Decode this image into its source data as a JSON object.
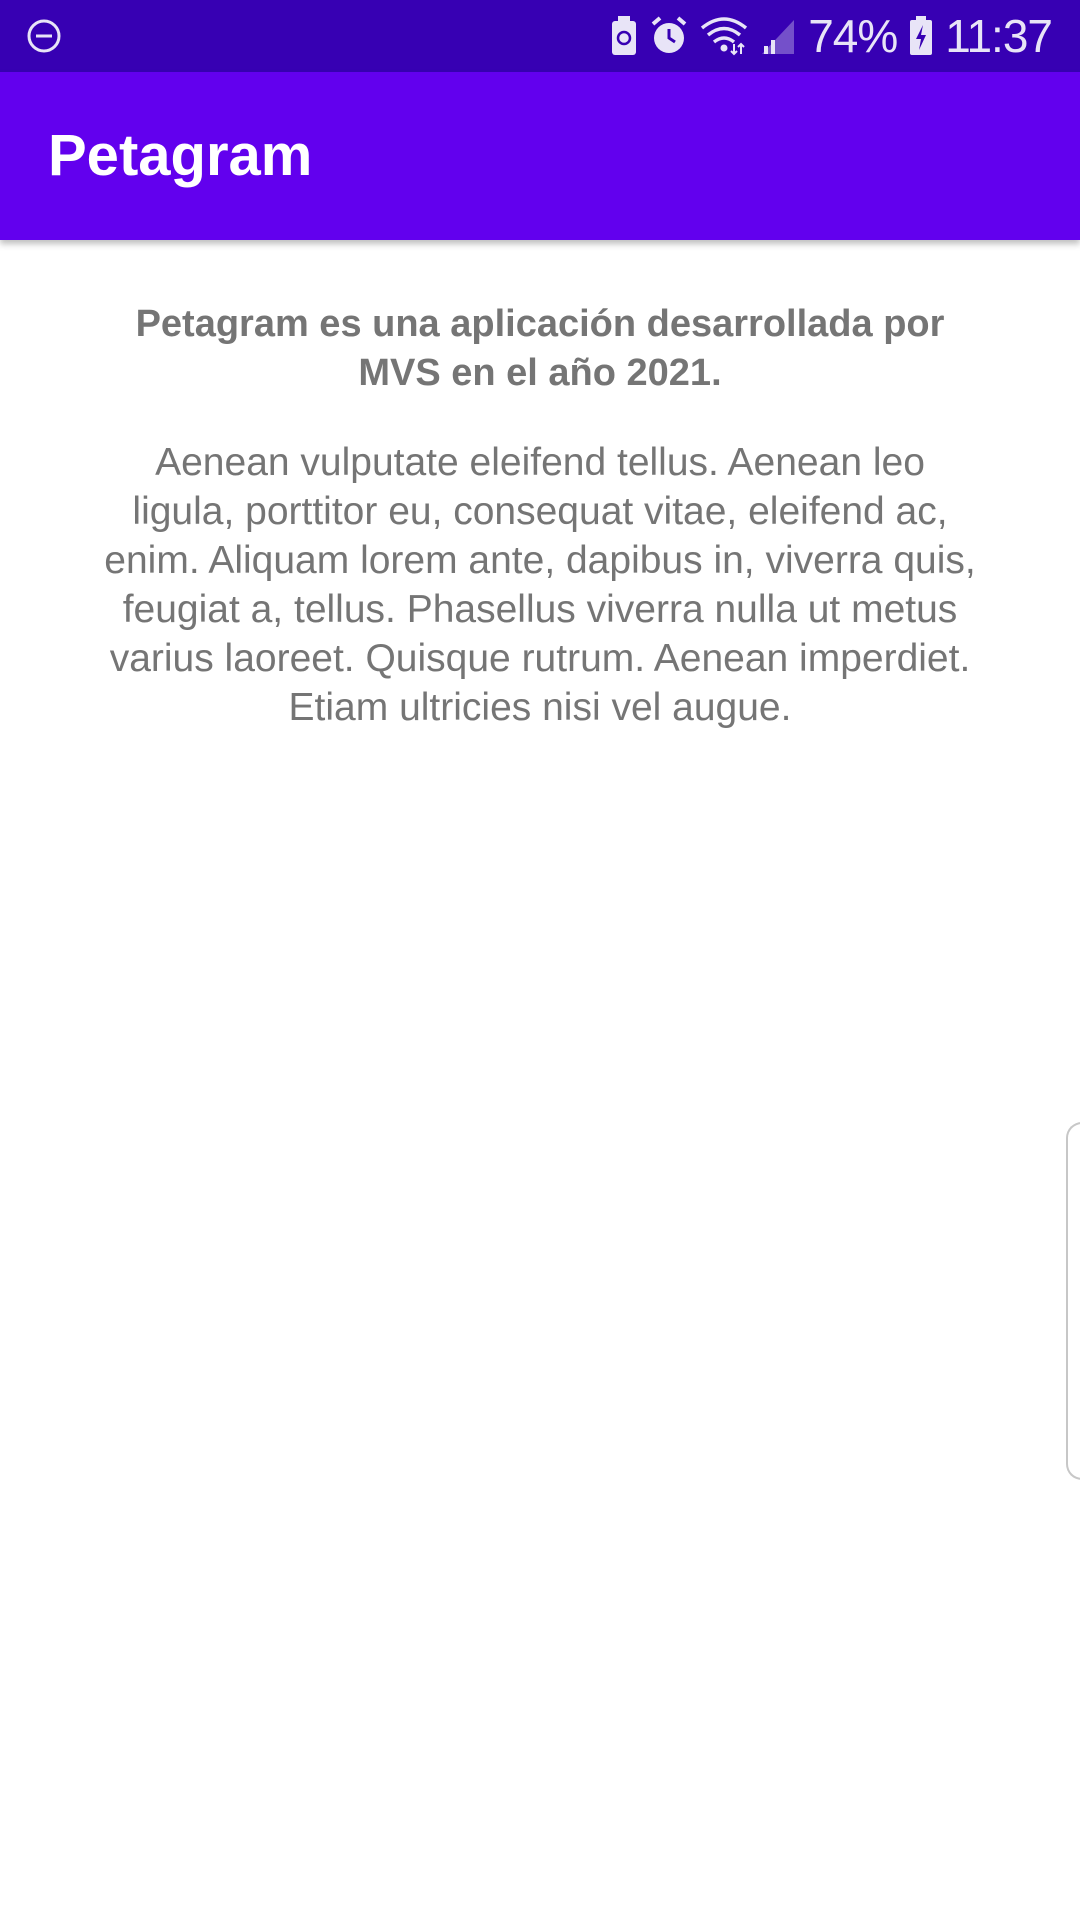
{
  "status_bar": {
    "battery_percent": "74%",
    "time": "11:37",
    "icons": [
      "do-not-disturb-icon",
      "battery-saver-icon",
      "alarm-icon",
      "wifi-icon",
      "signal-icon",
      "battery-charging-icon"
    ]
  },
  "app_bar": {
    "title": "Petagram",
    "background_color": "#6200EE"
  },
  "content": {
    "headline": "Petagram es una aplicación desarrollada por MVS en el año 2021.",
    "body": "Aenean vulputate eleifend tellus. Aenean leo ligula, porttitor eu, consequat vitae, eleifend ac, enim. Aliquam lorem ante, dapibus in, viverra quis, feugiat a, tellus. Phasellus viverra nulla ut metus varius laoreet. Quisque rutrum. Aenean imperdiet. Etiam ultricies nisi vel augue."
  },
  "colors": {
    "status_bar": "#3700B3",
    "text_secondary": "#757575"
  }
}
